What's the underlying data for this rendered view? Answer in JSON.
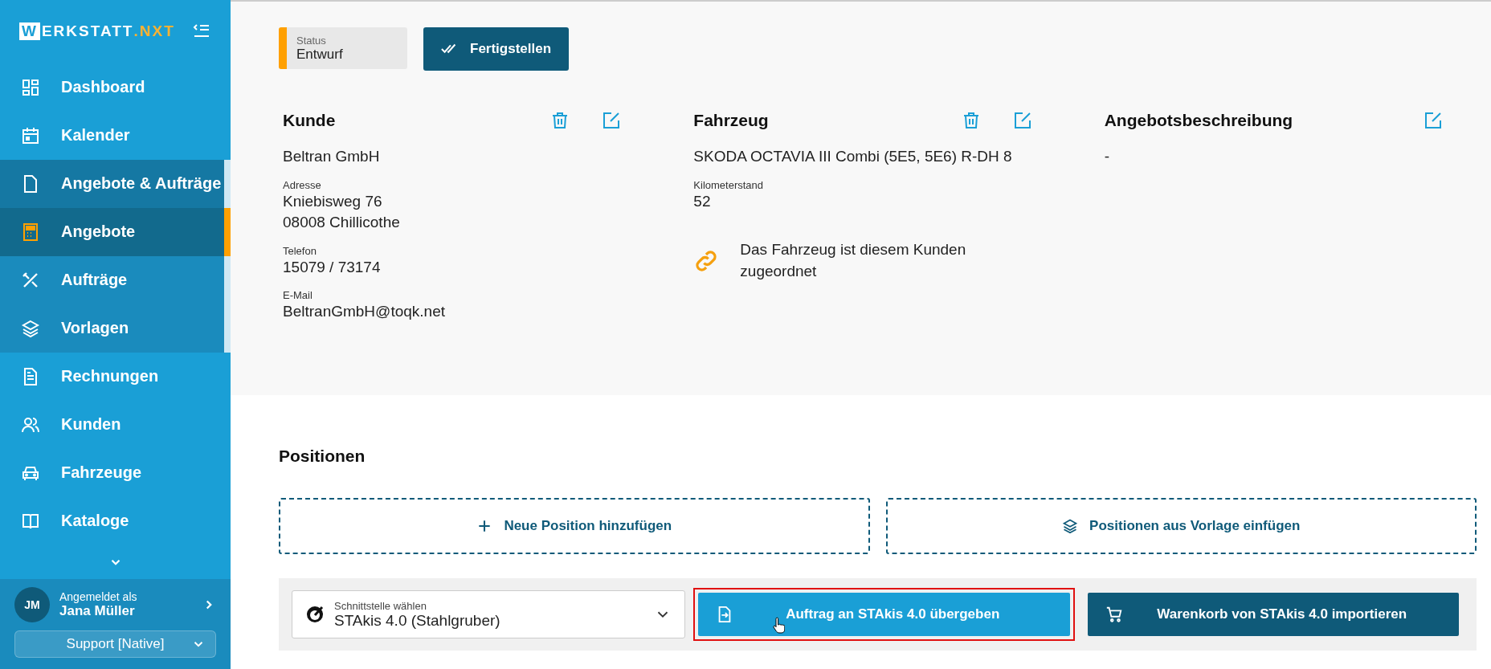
{
  "sidebar": {
    "logo": {
      "letter": "W",
      "text": "ERKSTATT",
      "accent": ".NXT"
    },
    "items": [
      {
        "label": "Dashboard",
        "kind": "dashboard",
        "selected": false
      },
      {
        "label": "Kalender",
        "kind": "calendar",
        "selected": false
      },
      {
        "label": "Angebote & Aufträge",
        "kind": "file",
        "selected": false,
        "expanded": true,
        "children": [
          {
            "label": "Angebote",
            "kind": "calculator",
            "selected": true
          },
          {
            "label": "Aufträge",
            "kind": "tools",
            "selected": false
          },
          {
            "label": "Vorlagen",
            "kind": "layers",
            "selected": false
          }
        ]
      },
      {
        "label": "Rechnungen",
        "kind": "document",
        "selected": false
      },
      {
        "label": "Kunden",
        "kind": "users",
        "selected": false
      },
      {
        "label": "Fahrzeuge",
        "kind": "car",
        "selected": false
      },
      {
        "label": "Kataloge",
        "kind": "book",
        "selected": false
      }
    ],
    "user": {
      "initials": "JM",
      "caption": "Angemeldet als",
      "name": "Jana Müller"
    },
    "role_select": {
      "value": "Support [Native]"
    }
  },
  "status": {
    "label": "Status",
    "value": "Entwurf",
    "color": "#ffa000"
  },
  "finish_button": "Fertigstellen",
  "sections": [
    {
      "title": "Kunde",
      "deletable": true,
      "fields": [
        {
          "value": "Beltran GmbH"
        },
        {
          "label": "Adresse",
          "value": "Kniebisweg 76\n08008 Chillicothe"
        },
        {
          "label": "Telefon",
          "value": "15079 / 73174"
        },
        {
          "label": "E-Mail",
          "value": "BeltranGmbH@toqk.net"
        }
      ]
    },
    {
      "title": "Fahrzeug",
      "deletable": true,
      "fields": [
        {
          "value": "SKODA OCTAVIA III Combi (5E5, 5E6) R-DH 8"
        },
        {
          "label": "Kilometerstand",
          "value": "52"
        }
      ],
      "note": "Das Fahrzeug ist diesem Kunden zugeordnet"
    },
    {
      "title": "Angebotsbeschreibung",
      "deletable": false,
      "fields": [
        {
          "value": "-"
        }
      ]
    }
  ],
  "positions": {
    "title": "Positionen",
    "add_buttons": [
      {
        "label": "Neue Position hinzufügen",
        "kind": "plus"
      },
      {
        "label": "Positionen aus Vorlage einfügen",
        "kind": "layers"
      }
    ]
  },
  "interface_bar": {
    "select": {
      "label": "Schnittstelle wählen",
      "value": "STAkis 4.0 (Stahlgruber)"
    },
    "buttons": [
      {
        "label": "Auftrag an STAkis 4.0 übergeben",
        "kind": "primary",
        "highlighted": true
      },
      {
        "label": "Warenkorb von STAkis 4.0 importieren",
        "kind": "dark",
        "highlighted": false
      }
    ]
  }
}
